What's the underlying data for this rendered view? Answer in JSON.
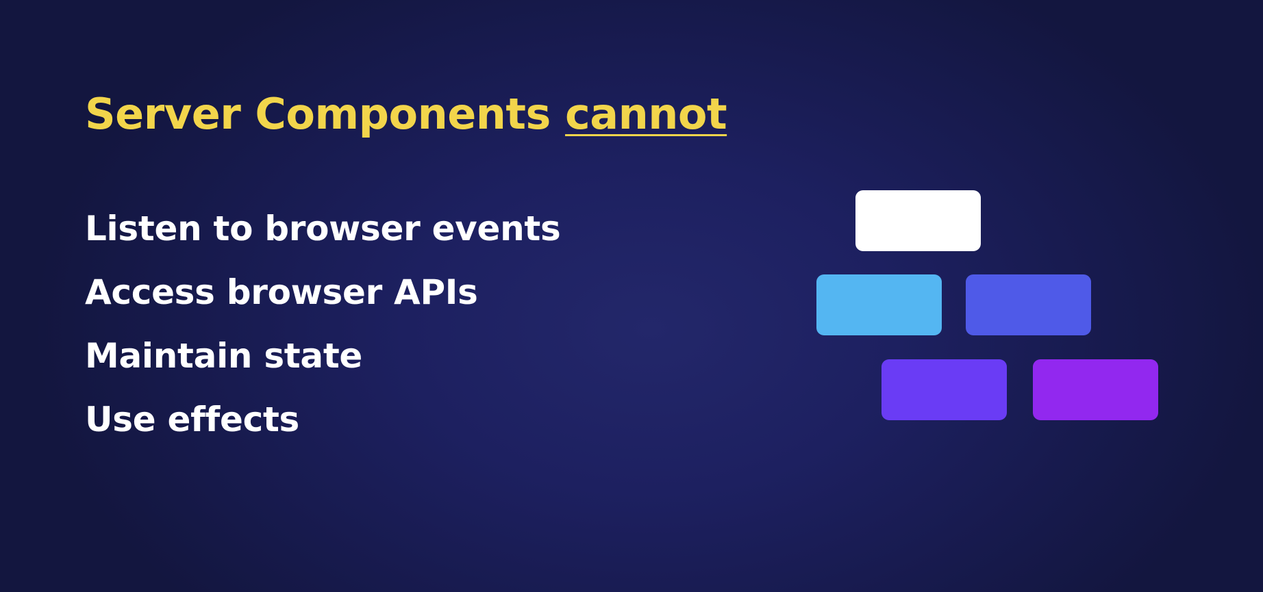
{
  "slide": {
    "title_lead": "Server Components ",
    "title_emphasis": "cannot",
    "items": [
      "Listen to browser events",
      "Access browser APIs",
      "Maintain state",
      "Use effects"
    ]
  },
  "colors": {
    "background": "#1b1e5a",
    "title": "#f2d54b",
    "text": "#ffffff",
    "block_top": "#ffffff",
    "block_middle_left": "#54b6f2",
    "block_middle_right": "#4f5ae8",
    "block_bottom_left": "#6a3cf5",
    "block_bottom_right": "#9228ef"
  }
}
